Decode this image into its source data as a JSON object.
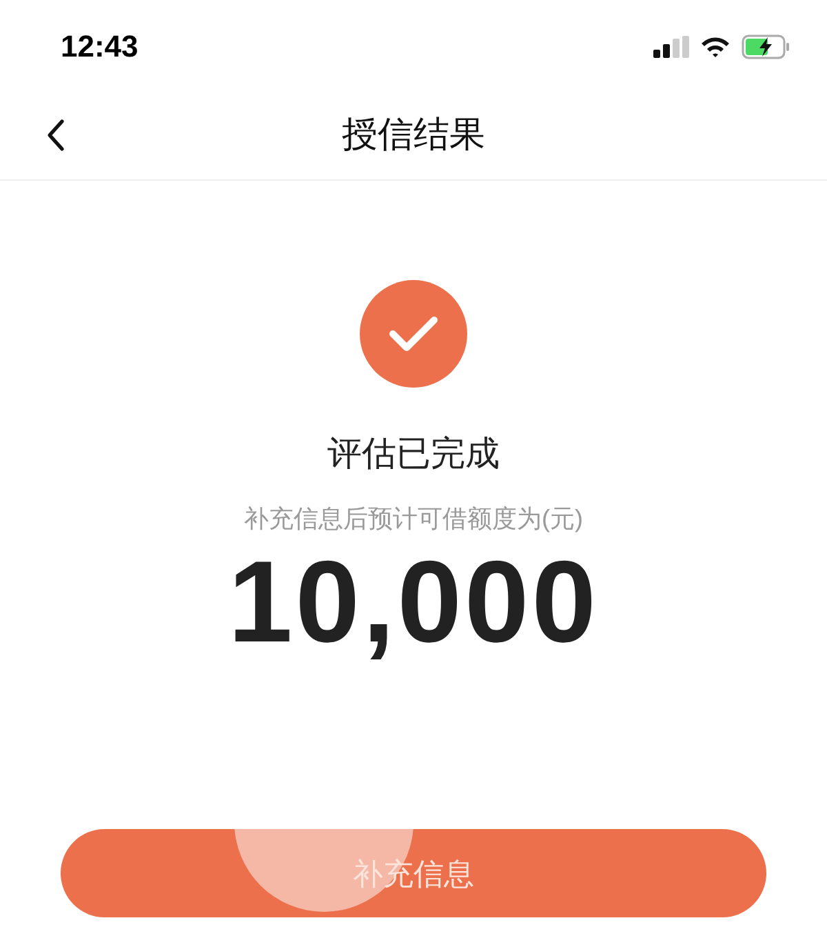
{
  "status_bar": {
    "time": "12:43",
    "charging": true
  },
  "nav": {
    "title": "授信结果"
  },
  "result": {
    "title": "评估已完成",
    "subtitle": "补充信息后预计可借额度为(元)",
    "amount": "10,000"
  },
  "button": {
    "label": "补充信息",
    "pressed": true
  }
}
